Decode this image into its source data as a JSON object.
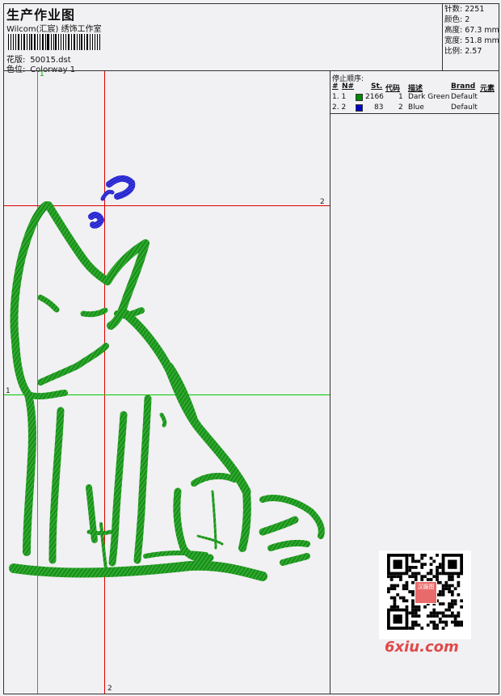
{
  "header": {
    "title": "生产作业图",
    "studio": "Wilcom(汇宸) 绣饰工作室",
    "design_label": "花版:",
    "design_value": "50015.dst",
    "color_label": "色位:",
    "color_value": "Colorway 1"
  },
  "stats": {
    "stitches": "针数: 2251",
    "colors": "颜色: 2",
    "height": "高度: 67.3 mm",
    "width": "宽度: 51.8 mm",
    "scale": "比例: 2.57"
  },
  "grid": {
    "v1_label": "1",
    "v2_label": "2",
    "h1_label": "1",
    "h2_label": "2",
    "line_green": "#00cc00",
    "line_red": "#dd0000"
  },
  "sequence": {
    "title": "停止顺序:",
    "headers": {
      "num": "#",
      "n": "N#",
      "st": "St.",
      "code": "代码",
      "desc": "描述",
      "brand": "Brand",
      "elem": "元素"
    },
    "rows": [
      {
        "idx": "1. 1",
        "color": "#008800",
        "st": "2166",
        "code": "1",
        "desc": "Dark Green",
        "brand": "Default"
      },
      {
        "idx": "2. 2",
        "color": "#0000cc",
        "st": "83",
        "code": "2",
        "desc": "Blue",
        "brand": "Default"
      }
    ]
  },
  "watermark": {
    "site": "6xiu.com",
    "qr_center": "汉服图",
    "accent": "#e04a4a"
  },
  "threads": {
    "dark_green": "#1a9a1a",
    "blue": "#1a1ad0"
  }
}
